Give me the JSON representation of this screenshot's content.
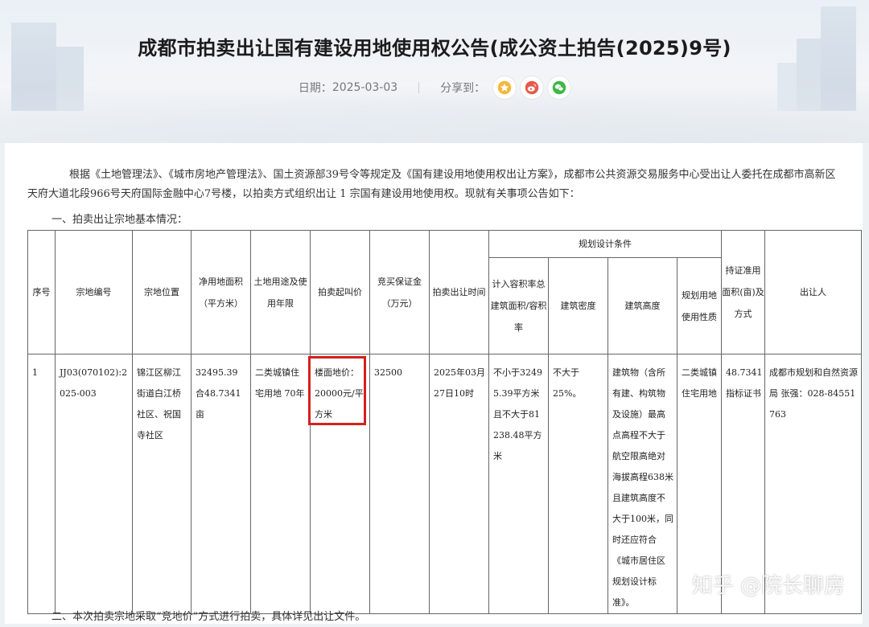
{
  "header": {
    "title": "成都市拍卖出让国有建设用地使用权公告(成公资土拍告(2025)9号)",
    "date_label": "日期：",
    "date": "2025-03-03",
    "share_label": "分享到：",
    "share_icons": [
      "star-icon",
      "weibo-icon",
      "wechat-icon"
    ]
  },
  "body": {
    "intro": "根据《土地管理法》、《城市房地产管理法》、国土资源部39号令等规定及《国有建设用地使用权出让方案》，成都市公共资源交易服务中心受出让人委托在成都市高新区天府大道北段966号天府国际金融中心7号楼，以拍卖方式组织出让 1 宗国有建设用地使用权。现就有关事项公告如下：",
    "section1": "一、拍卖出让宗地基本情况：",
    "section2": "二、本次拍卖宗地采取“竞地价”方式进行拍卖，具体详见出让文件。"
  },
  "table": {
    "headers": {
      "seq": "序号",
      "parcel_no": "宗地编号",
      "location": "宗地位置",
      "net_area": "净用地面积（平方米）",
      "use_years": "土地用途及使用年限",
      "start_price": "拍卖起叫价",
      "deposit": "竞买保证金（万元）",
      "auction_time": "拍卖出让时间",
      "planning": "规划设计条件",
      "far": "计入容积率总建筑面积/容积率",
      "density": "建筑密度",
      "height": "建筑高度",
      "land_use": "规划用地使用性质",
      "quota": "持证准用面积(亩)及方式",
      "grantor": "出让人"
    },
    "row": {
      "seq": "1",
      "parcel_no": "JJ03(070102):2025-003",
      "location": "锦江区柳江街道白江桥社区、祝国寺社区",
      "net_area": "32495.39 合48.7341亩",
      "use_years": "二类城镇住宅用地 70年",
      "start_price": "楼面地价：20000元/平方米",
      "deposit": "32500",
      "auction_time": "2025年03月27日10时",
      "far": "不小于32495.39平方米且不大于81238.48平方米",
      "density": "不大于25%。",
      "height": "建筑物（含所有建、构筑物及设施）最高点高程不大于航空限高绝对海拔高程638米且建筑高度不大于100米，同时还应符合《城市居住区规划设计标准》。",
      "land_use": "二类城镇住宅用地",
      "quota": "48.7341 指标证书",
      "grantor": "成都市规划和自然资源局 张强：028-84551763"
    }
  },
  "watermark": "知乎 @院长聊房"
}
